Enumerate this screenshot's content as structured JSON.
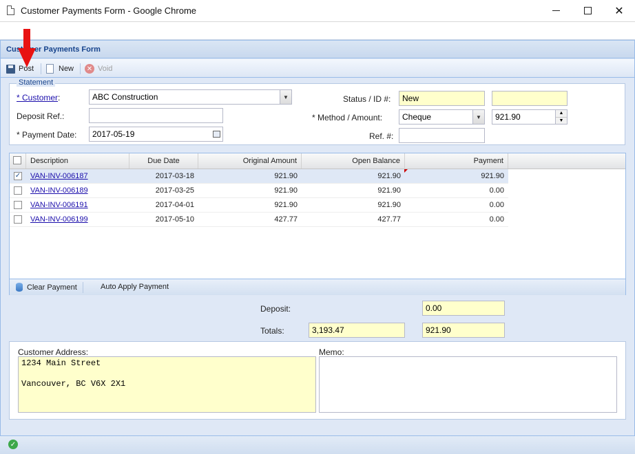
{
  "window": {
    "title": "Customer Payments Form - Google Chrome"
  },
  "panel": {
    "title": "Customer Payments Form"
  },
  "toolbar": {
    "post_label": "Post",
    "new_label": "New",
    "void_label": "Void"
  },
  "statement": {
    "legend": "Statement",
    "customer_label": "Customer",
    "customer_required": "* ",
    "customer_value": "ABC Construction",
    "deposit_ref_label": "Deposit Ref.:",
    "deposit_ref_value": "",
    "payment_date_label": "* Payment Date:",
    "payment_date_value": "2017-05-19",
    "status_id_label": "Status / ID #:",
    "status_value": "New",
    "id_value": "",
    "method_amount_label": "* Method / Amount:",
    "method_value": "Cheque",
    "amount_value": "921.90",
    "ref_label": "Ref. #:",
    "ref_value": ""
  },
  "grid": {
    "columns": [
      "Description",
      "Due Date",
      "Original Amount",
      "Open Balance",
      "Payment"
    ],
    "rows": [
      {
        "checked": "✓",
        "description": "VAN-INV-006187",
        "due_date": "2017-03-18",
        "original": "921.90",
        "open": "921.90",
        "payment": "921.90"
      },
      {
        "checked": "",
        "description": "VAN-INV-006189",
        "due_date": "2017-03-25",
        "original": "921.90",
        "open": "921.90",
        "payment": "0.00"
      },
      {
        "checked": "",
        "description": "VAN-INV-006191",
        "due_date": "2017-04-01",
        "original": "921.90",
        "open": "921.90",
        "payment": "0.00"
      },
      {
        "checked": "",
        "description": "VAN-INV-006199",
        "due_date": "2017-05-10",
        "original": "427.77",
        "open": "427.77",
        "payment": "0.00"
      }
    ],
    "clear_payment_label": "Clear Payment",
    "auto_apply_label": "Auto Apply Payment"
  },
  "totals": {
    "deposit_label": "Deposit:",
    "deposit_value": "0.00",
    "totals_label": "Totals:",
    "open_total": "3,193.47",
    "payment_total": "921.90"
  },
  "address": {
    "label": "Customer Address:",
    "value": "1234 Main Street\n\nVancouver, BC V6X 2X1"
  },
  "memo": {
    "label": "Memo:",
    "value": ""
  }
}
